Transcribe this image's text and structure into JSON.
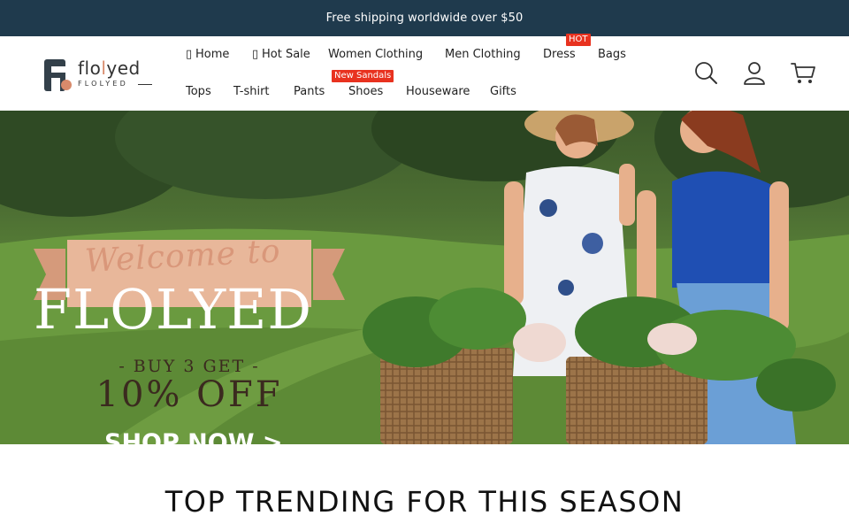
{
  "announcement": {
    "text": "Free shipping worldwide over $50"
  },
  "logo": {
    "word_start": "flo",
    "word_accent": "l",
    "word_end": "yed",
    "subtitle": "FLOLYED"
  },
  "nav": {
    "items": [
      {
        "label": "Home",
        "icon": "home-icon"
      },
      {
        "label": "Hot Sale",
        "icon": "fire-icon"
      },
      {
        "label": "Women Clothing"
      },
      {
        "label": "Men Clothing"
      },
      {
        "label": "Dress",
        "badge": "HOT"
      },
      {
        "label": "Bags"
      },
      {
        "label": "Tops"
      },
      {
        "label": "T-shirt"
      },
      {
        "label": "Pants"
      },
      {
        "label": "Shoes",
        "badge": "New Sandals"
      },
      {
        "label": "Houseware"
      },
      {
        "label": "Gifts"
      }
    ]
  },
  "header_icons": [
    "search-icon",
    "account-icon",
    "cart-icon"
  ],
  "hero": {
    "script": "Welcome to",
    "brand": "FLOLYED",
    "promo_line1": "- BUY 3 GET -",
    "promo_line2": "10% OFF",
    "cta": "SHOP NOW >"
  },
  "section": {
    "title": "TOP TRENDING FOR THIS SEASON"
  },
  "colors": {
    "topbar": "#1f3a4d",
    "badge": "#e8321f",
    "accent": "#d88a6b",
    "ribbon": "#e8b79a"
  }
}
